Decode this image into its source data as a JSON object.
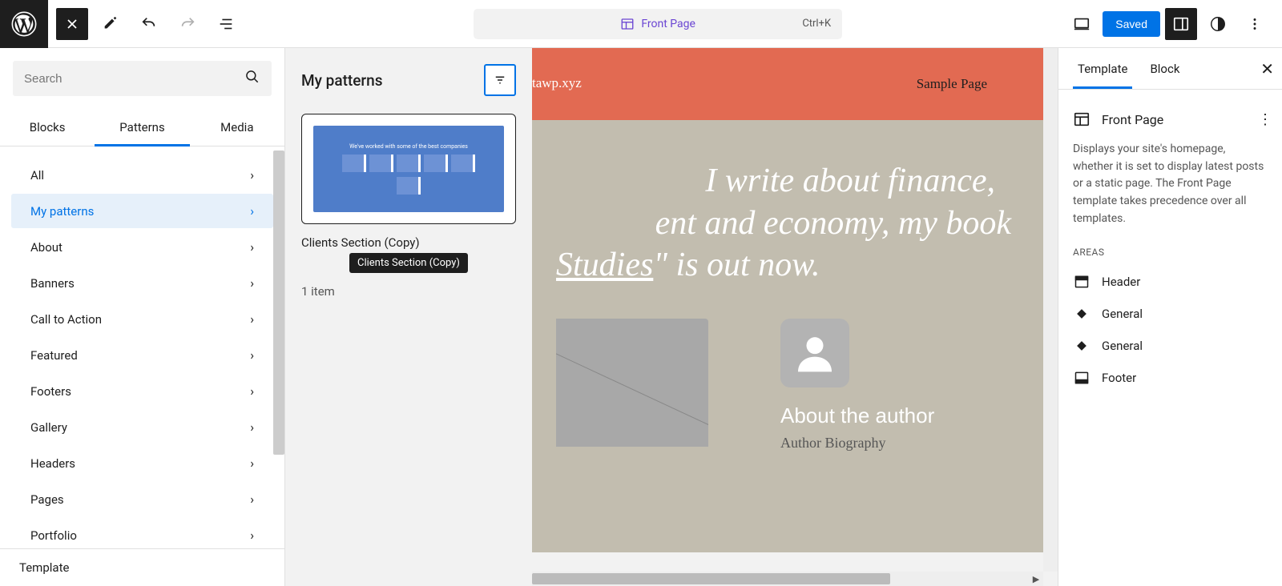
{
  "topbar": {
    "document_title": "Front Page",
    "shortcut": "Ctrl+K",
    "saved_label": "Saved"
  },
  "inserter": {
    "search_placeholder": "Search",
    "tabs": [
      "Blocks",
      "Patterns",
      "Media"
    ],
    "active_tab": 1,
    "categories": [
      {
        "label": "All"
      },
      {
        "label": "My patterns"
      },
      {
        "label": "About"
      },
      {
        "label": "Banners"
      },
      {
        "label": "Call to Action"
      },
      {
        "label": "Featured"
      },
      {
        "label": "Footers"
      },
      {
        "label": "Gallery"
      },
      {
        "label": "Headers"
      },
      {
        "label": "Pages"
      },
      {
        "label": "Portfolio"
      }
    ],
    "active_category": 1,
    "bottom_label": "Template"
  },
  "patterns_panel": {
    "title": "My patterns",
    "preview_text": "We've worked with some of the best companies",
    "pattern_name": "Clients Section (Copy)",
    "tooltip": "Clients Section (Copy)",
    "count_label": "1 item"
  },
  "canvas": {
    "site_url": "tawp.xyz",
    "nav_link": "Sample Page",
    "hero_line1": "I write about finance,",
    "hero_line2": "ent and economy, my book",
    "hero_line3a": "Studies",
    "hero_line3b": "\" is out now.",
    "about_heading": "About the author",
    "author_bio": "Author Biography"
  },
  "settings": {
    "tabs": [
      "Template",
      "Block"
    ],
    "active_tab": 0,
    "template_name": "Front Page",
    "description": "Displays your site's homepage, whether it is set to display latest posts or a static page. The Front Page template takes precedence over all templates.",
    "areas_title": "Areas",
    "areas": [
      {
        "label": "Header",
        "icon": "header"
      },
      {
        "label": "General",
        "icon": "diamond"
      },
      {
        "label": "General",
        "icon": "diamond"
      },
      {
        "label": "Footer",
        "icon": "footer"
      }
    ]
  }
}
